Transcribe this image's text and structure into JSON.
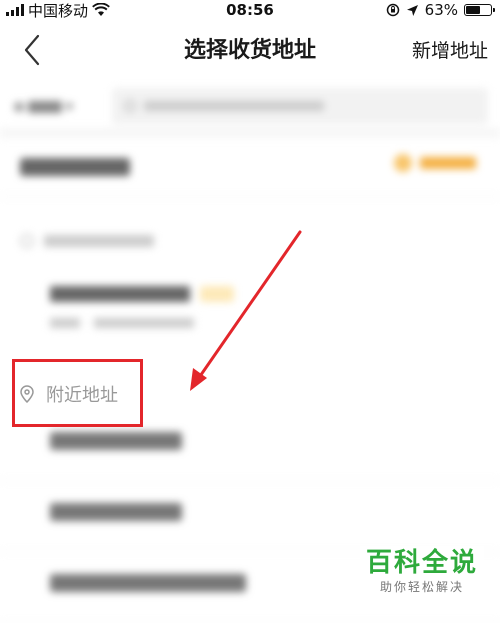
{
  "status_bar": {
    "carrier": "中国移动",
    "time": "08:56",
    "battery_text": "63%",
    "battery_level": 0.63
  },
  "nav": {
    "title": "选择收货地址",
    "add_address_label": "新增地址"
  },
  "search": {
    "city": "",
    "placeholder": ""
  },
  "current_location": {
    "text": "",
    "relocate_label": ""
  },
  "saved_section": {
    "header": "",
    "item_name": "",
    "item_tag": "",
    "item_contact": "",
    "item_phone": ""
  },
  "nearby_section": {
    "header": "附近地址",
    "items": [
      "",
      "",
      ""
    ]
  },
  "watermark": {
    "title": "百科全说",
    "subtitle": "助你轻松解决"
  },
  "colors": {
    "accent": "#f4a62a",
    "annotation_red": "#e3262b",
    "watermark_green": "#2eaa3c"
  }
}
